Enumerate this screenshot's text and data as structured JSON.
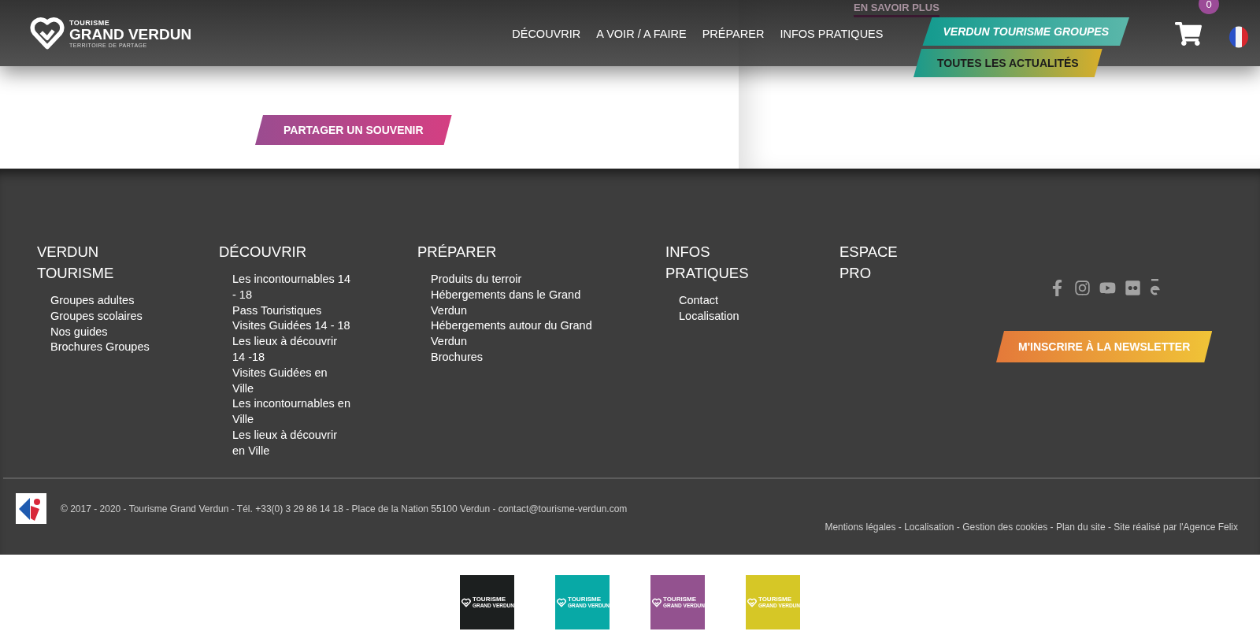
{
  "header": {
    "logo": {
      "top": "TOURISME",
      "name": "GRAND VERDUN",
      "tagline": "TERRITOIRE DE PARTAGE"
    },
    "nav": [
      "DÉCOUVRIR",
      "A VOIR / A FAIRE",
      "PRÉPARER",
      "INFOS PRATIQUES"
    ],
    "cta": "VERDUN TOURISME GROUPES",
    "cart_count": "0"
  },
  "content": {
    "share_button": "PARTAGER UN SOUVENIR",
    "more_link": "EN SAVOIR PLUS",
    "news_button": "TOUTES LES ACTUALITÉS"
  },
  "footer": {
    "columns": [
      {
        "title": "VERDUN TOURISME",
        "links": [
          "Groupes adultes",
          "Groupes scolaires",
          "Nos guides",
          "Brochures Groupes"
        ]
      },
      {
        "title": "DÉCOUVRIR",
        "links": [
          "Les incontournables 14 - 18",
          "Pass Touristiques",
          "Visites Guidées 14 - 18",
          "Les lieux à découvrir 14 -18",
          "Visites Guidées en Ville",
          "Les incontournables en Ville",
          "Les lieux à découvrir en Ville"
        ]
      },
      {
        "title": "PRÉPARER",
        "links": [
          "Produits du terroir",
          "Hébergements dans le Grand Verdun",
          "Hébergements autour du Grand Verdun",
          "Brochures"
        ]
      },
      {
        "title": "INFOS PRATIQUES",
        "links": [
          "Contact",
          "Localisation"
        ]
      },
      {
        "title": "ESPACE PRO"
      }
    ],
    "social": [
      {
        "kind": "facebook"
      },
      {
        "kind": "instagram"
      },
      {
        "kind": "youtube"
      },
      {
        "kind": "flickr"
      },
      {
        "kind": "e"
      }
    ],
    "newsletter_button": "M'INSCRIRE À LA NEWSLETTER",
    "copyright": "© 2017 - 2020 - Tourisme Grand Verdun - Tél. +33(0) 3 29 86 14 18 - Place de la Nation 55100 Verdun - contact@tourisme-verdun.com",
    "legal": "Mentions légales - Localisation - Gestion des cookies - Plan du site - Site réalisé par l'Agence Felix"
  },
  "partner_tiles": [
    {
      "color": "#1c1f1f",
      "top": "TOURISME",
      "name": "GRAND VERDUN"
    },
    {
      "color": "#08a9a6",
      "top": "TOURISME",
      "name": "GRAND VERDUN"
    },
    {
      "color": "#93528f",
      "top": "TOURISME",
      "name": "GRAND VERDUN"
    },
    {
      "color": "#d6c726",
      "top": "TOURISME",
      "name": "GRAND VERDUN"
    }
  ]
}
